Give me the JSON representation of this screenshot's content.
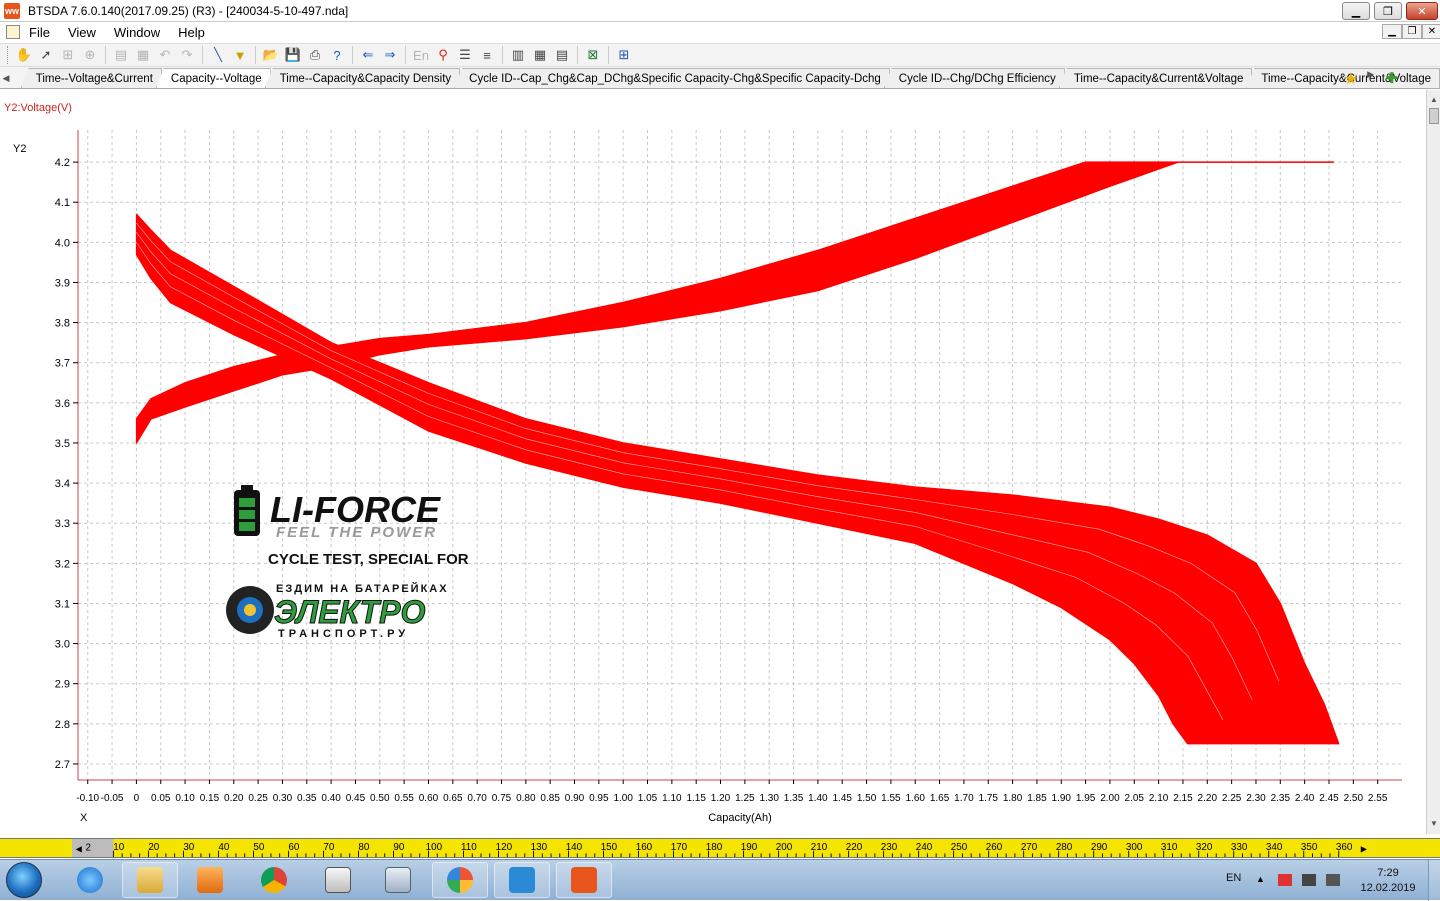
{
  "window": {
    "title": "BTSDA 7.6.0.140(2017.09.25) (R3) - [240034-5-10-497.nda]",
    "icon": "ww"
  },
  "menu": [
    "File",
    "View",
    "Window",
    "Help"
  ],
  "tabs": [
    {
      "label": "Time--Voltage&Current",
      "active": false
    },
    {
      "label": "Capacity--Voltage",
      "active": true
    },
    {
      "label": "Time--Capacity&Capacity Density",
      "active": false
    },
    {
      "label": "Cycle ID--Cap_Chg&Cap_DChg&Specific Capacity-Chg&Specific Capacity-Dchg",
      "active": false
    },
    {
      "label": "Cycle ID--Chg/DChg Efficiency",
      "active": false
    },
    {
      "label": "Time--Capacity&Current&Voltage",
      "active": false
    },
    {
      "label": "Time--Capacity&Current&Voltage",
      "active": false
    }
  ],
  "chart_data": {
    "type": "line",
    "y2_caption": "Y2:Voltage(V)",
    "y_axis_name": "Y2",
    "x_axis_name": "X",
    "xlabel": "Capacity(Ah)",
    "xlim": [
      -0.12,
      2.6
    ],
    "ylim": [
      2.66,
      4.28
    ],
    "x_ticks": [
      -0.1,
      -0.05,
      0,
      0.05,
      0.1,
      0.15,
      0.2,
      0.25,
      0.3,
      0.35,
      0.4,
      0.45,
      0.5,
      0.55,
      0.6,
      0.65,
      0.7,
      0.75,
      0.8,
      0.85,
      0.9,
      0.95,
      1.0,
      1.05,
      1.1,
      1.15,
      1.2,
      1.25,
      1.3,
      1.35,
      1.4,
      1.45,
      1.5,
      1.55,
      1.6,
      1.65,
      1.7,
      1.75,
      1.8,
      1.85,
      1.9,
      1.95,
      2.0,
      2.05,
      2.1,
      2.15,
      2.2,
      2.25,
      2.3,
      2.35,
      2.4,
      2.45,
      2.5,
      2.55
    ],
    "x_tick_labels": [
      "-0.10",
      "-0.05",
      "0",
      "0.05",
      "0.10",
      "0.15",
      "0.20",
      "0.25",
      "0.30",
      "0.35",
      "0.40",
      "0.45",
      "0.50",
      "0.55",
      "0.60",
      "0.65",
      "0.70",
      "0.75",
      "0.80",
      "0.85",
      "0.90",
      "0.95",
      "1.00",
      "1.05",
      "1.10",
      "1.15",
      "1.20",
      "1.25",
      "1.30",
      "1.35",
      "1.40",
      "1.45",
      "1.50",
      "1.55",
      "1.60",
      "1.65",
      "1.70",
      "1.75",
      "1.80",
      "1.85",
      "1.90",
      "1.95",
      "2.00",
      "2.05",
      "2.10",
      "2.15",
      "2.20",
      "2.25",
      "2.30",
      "2.35",
      "2.40",
      "2.45",
      "2.50",
      "2.55"
    ],
    "y_ticks": [
      2.7,
      2.8,
      2.9,
      3.0,
      3.1,
      3.2,
      3.3,
      3.4,
      3.5,
      3.6,
      3.7,
      3.8,
      3.9,
      4.0,
      4.1,
      4.2
    ],
    "y_tick_labels": [
      "2.7",
      "2.8",
      "2.9",
      "3.0",
      "3.1",
      "3.2",
      "3.3",
      "3.4",
      "3.5",
      "3.6",
      "3.7",
      "3.8",
      "3.9",
      "4.0",
      "4.1",
      "4.2"
    ],
    "grid": true,
    "color": "#ff0000",
    "series": [
      {
        "kind": "charge-upper",
        "x": [
          0,
          0.03,
          0.1,
          0.2,
          0.3,
          0.4,
          0.5,
          0.6,
          0.8,
          1.0,
          1.2,
          1.4,
          1.6,
          1.8,
          1.95,
          2.05,
          2.2,
          2.46
        ],
        "y": [
          3.56,
          3.61,
          3.65,
          3.69,
          3.72,
          3.74,
          3.76,
          3.77,
          3.8,
          3.85,
          3.91,
          3.98,
          4.06,
          4.14,
          4.2,
          4.2,
          4.2,
          4.2
        ]
      },
      {
        "kind": "charge-lower",
        "x": [
          0,
          0.03,
          0.1,
          0.2,
          0.3,
          0.4,
          0.5,
          0.6,
          0.8,
          1.0,
          1.2,
          1.4,
          1.6,
          1.8,
          2.0,
          2.14
        ],
        "y": [
          3.5,
          3.56,
          3.59,
          3.63,
          3.67,
          3.69,
          3.72,
          3.74,
          3.76,
          3.79,
          3.83,
          3.88,
          3.96,
          4.05,
          4.14,
          4.2
        ]
      },
      {
        "kind": "discharge-upper",
        "x": [
          0,
          0.03,
          0.07,
          0.2,
          0.4,
          0.6,
          0.8,
          1.0,
          1.2,
          1.4,
          1.6,
          1.8,
          2.0,
          2.1,
          2.2,
          2.3,
          2.35,
          2.4,
          2.44,
          2.47
        ],
        "y": [
          4.07,
          4.03,
          3.98,
          3.89,
          3.75,
          3.65,
          3.56,
          3.5,
          3.46,
          3.42,
          3.39,
          3.37,
          3.34,
          3.31,
          3.27,
          3.2,
          3.1,
          2.95,
          2.85,
          2.75
        ]
      },
      {
        "kind": "discharge-lower",
        "x": [
          0,
          0.03,
          0.07,
          0.2,
          0.4,
          0.6,
          0.8,
          1.0,
          1.2,
          1.4,
          1.6,
          1.8,
          1.9,
          2.0,
          2.05,
          2.1,
          2.13,
          2.16
        ],
        "y": [
          3.97,
          3.91,
          3.85,
          3.77,
          3.66,
          3.53,
          3.45,
          3.39,
          3.35,
          3.3,
          3.25,
          3.15,
          3.09,
          3.01,
          2.95,
          2.87,
          2.8,
          2.75
        ]
      }
    ]
  },
  "watermark": {
    "brand": "LI-FORCE",
    "slogan": "FEEL THE POWER",
    "caption": "CYCLE TEST, SPECIAL FOR",
    "partner_top": "ЕЗДИМ НА БАТАРЕЙКАХ",
    "partner_main": "ЭЛЕКТРО",
    "partner_bottom": "ТРАНСПОРТ.РУ",
    "brand_color": "#2e9e3c",
    "partner_color": "#2e9e3c"
  },
  "ruler": {
    "first": "2",
    "labels": [
      "10",
      "20",
      "30",
      "40",
      "50",
      "60",
      "70",
      "80",
      "90",
      "100",
      "110",
      "120",
      "130",
      "140",
      "150",
      "160",
      "170",
      "180",
      "190",
      "200",
      "210",
      "220",
      "230",
      "240",
      "250",
      "260",
      "270",
      "280",
      "290",
      "300",
      "310",
      "320",
      "330",
      "340",
      "350",
      "360"
    ]
  },
  "taskbar": {
    "apps": [
      "start-orb",
      "internet-explorer-icon",
      "file-explorer-icon",
      "media-player-icon",
      "chrome-icon",
      "package-icon",
      "calculator-icon",
      "paint-icon",
      "btsda-client-icon",
      "btsda-app-icon"
    ],
    "language": "EN",
    "time": "7:29",
    "date": "12.02.2019"
  }
}
